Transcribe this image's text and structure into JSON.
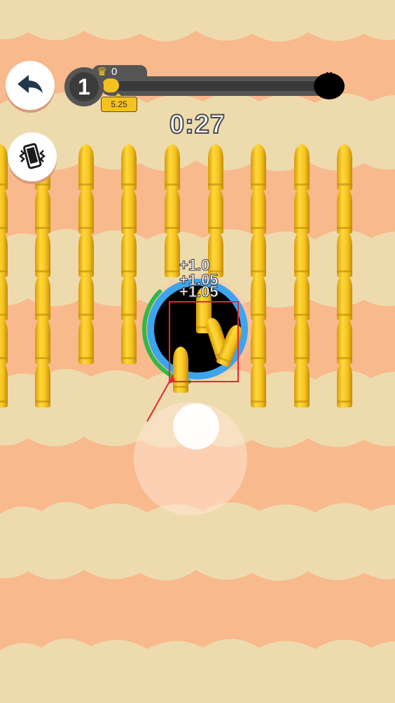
{
  "colors": {
    "background": "#f8b98c",
    "cloud": "#eddbae",
    "bullet": "#f4c21f",
    "hole_ring": "#3da4ee",
    "progress_fill": "#f2c31b",
    "annotation": "#e8262c"
  },
  "hud": {
    "level": "1",
    "crown_count": "0",
    "hole_size": "5.25",
    "timer": "0:27",
    "level_progress": 0.03,
    "enemy_icon": "black-hole-icon"
  },
  "buttons": {
    "back_icon": "back-arrow-icon",
    "vibrate_icon": "vibrate-phone-icon"
  },
  "score_popups": [
    "+1.0",
    "+1.05",
    "+1.05"
  ],
  "hole": {
    "growth_progress": 0.35
  },
  "joystick": {
    "visible": true
  }
}
